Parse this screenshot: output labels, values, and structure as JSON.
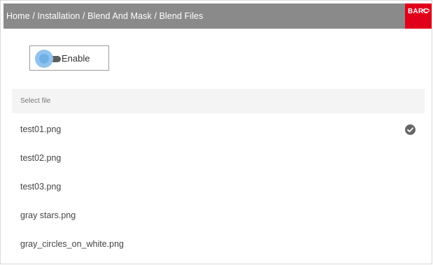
{
  "header": {
    "breadcrumb": "Home / Installation / Blend And Mask / Blend Files",
    "logo_text": "BARC",
    "brand_color": "#e1001a"
  },
  "enable": {
    "label": "Enable",
    "toggle_state": "off"
  },
  "file_selector": {
    "header_label": "Select file",
    "selected_icon": "check-circle-icon",
    "files": [
      {
        "name": "test01.png",
        "selected": true
      },
      {
        "name": "test02.png",
        "selected": false
      },
      {
        "name": "test03.png",
        "selected": false
      },
      {
        "name": "gray stars.png",
        "selected": false
      },
      {
        "name": "gray_circles_on_white.png",
        "selected": false
      }
    ]
  }
}
